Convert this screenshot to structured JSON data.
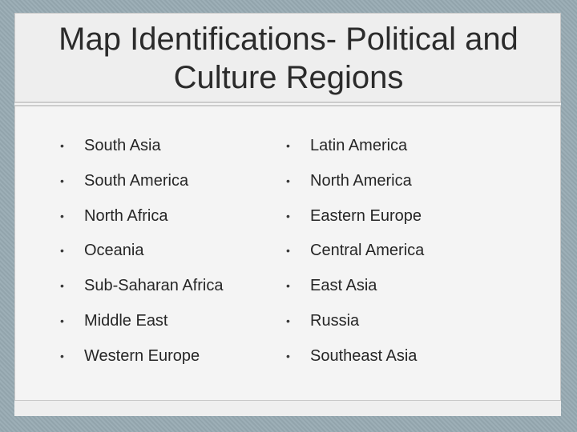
{
  "title": "Map Identifications- Political and Culture Regions",
  "left_items": [
    "South Asia",
    "South America",
    "North Africa",
    "Oceania",
    "Sub-Saharan Africa",
    "Middle East",
    "Western Europe"
  ],
  "right_items": [
    "Latin America",
    "North America",
    "Eastern Europe",
    "Central America",
    "East Asia",
    "Russia",
    "Southeast Asia"
  ],
  "bullet_glyph": "•"
}
